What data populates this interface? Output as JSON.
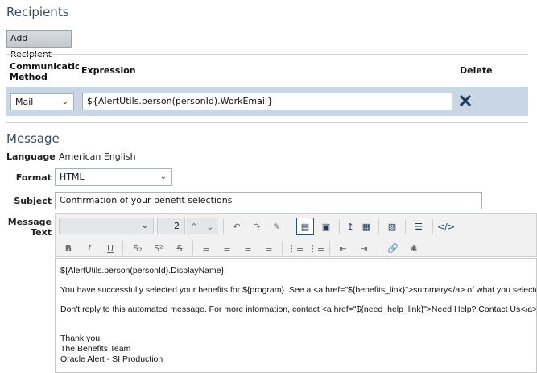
{
  "recipients": {
    "title": "Recipients",
    "add_button": "Add Recipient",
    "columns": {
      "method": "Communication Method",
      "expression": "Expression",
      "delete": "Delete"
    },
    "row": {
      "method": "Mail",
      "expression": "${AlertUtils.person(personId).WorkEmail}"
    }
  },
  "message": {
    "title": "Message",
    "language_label": "Language",
    "language_value": "American English",
    "format_label": "Format",
    "format_value": "HTML",
    "subject_label": "Subject",
    "subject_value": "Confirmation of your benefit selections",
    "text_label": "Message Text",
    "font_size": "2",
    "body_lines": [
      "${AlertUtils.person(personId).DisplayName},",
      "You have successfully selected your benefits for ${program}. See a <a href=\"${benefits_link}\">summary</a> of what you selecte",
      "Don't reply to this automated message. For more information, contact <a href=\"${need_help_link}\">Need Help? Contact Us</a>",
      "Thank you,",
      "The Benefits Team",
      "Oracle Alert - SI Production"
    ]
  },
  "icons": {
    "delete": "close-x-icon",
    "accent": "#1f3a5c"
  }
}
